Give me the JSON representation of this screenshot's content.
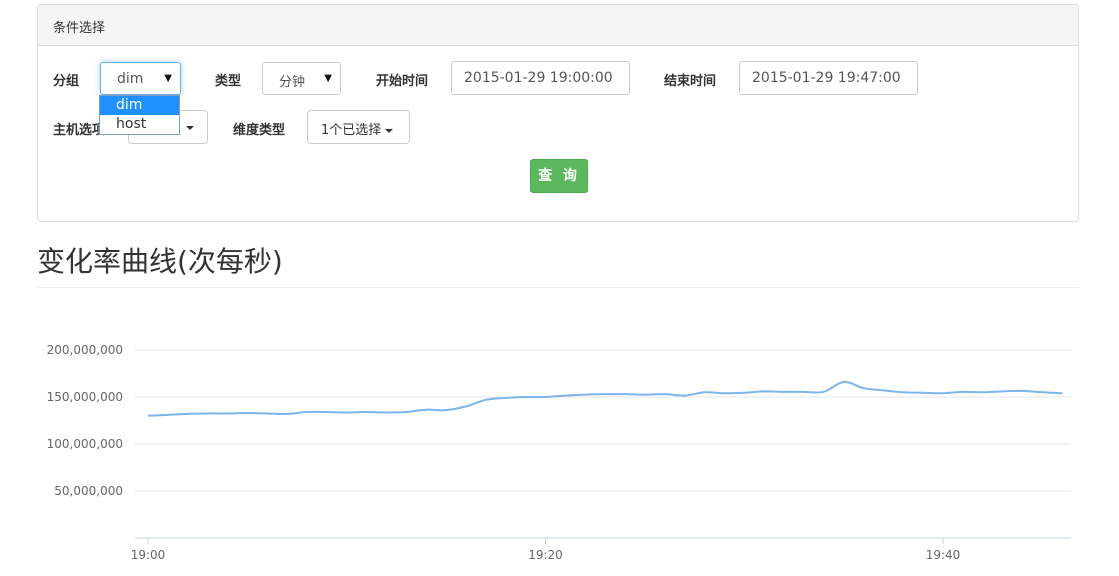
{
  "panel": {
    "title": "条件选择"
  },
  "filters": {
    "group": {
      "label": "分组",
      "value": "dim",
      "options": [
        "dim",
        "host"
      ]
    },
    "type": {
      "label": "类型",
      "value": "分钟"
    },
    "start_time": {
      "label": "开始时间",
      "value": "2015-01-29 19:00:00"
    },
    "end_time": {
      "label": "结束时间",
      "value": "2015-01-29 19:47:00"
    },
    "host_select": {
      "label": "主机选项",
      "value": ""
    },
    "dimension_type": {
      "label": "维度类型",
      "value": "1个已选择"
    },
    "query_button": "查 询"
  },
  "chart_title": "变化率曲线(次每秒)",
  "chart_data": {
    "type": "line",
    "title": "变化率曲线(次每秒)",
    "x_tick_labels": [
      "19:00",
      "19:20",
      "19:40"
    ],
    "y_tick_labels": [
      "50,000,000",
      "100,000,000",
      "150,000,000",
      "200,000,000"
    ],
    "ylim": [
      0,
      200000000
    ],
    "grid": true,
    "colors": {
      "line": "#7cb5ec"
    },
    "series": [
      {
        "x": [
          "19:00",
          "19:01",
          "19:02",
          "19:03",
          "19:04",
          "19:05",
          "19:06",
          "19:07",
          "19:08",
          "19:09",
          "19:10",
          "19:11",
          "19:12",
          "19:13",
          "19:14",
          "19:15",
          "19:16",
          "19:17",
          "19:18",
          "19:19",
          "19:20",
          "19:21",
          "19:22",
          "19:23",
          "19:24",
          "19:25",
          "19:26",
          "19:27",
          "19:28",
          "19:29",
          "19:30",
          "19:31",
          "19:32",
          "19:33",
          "19:34",
          "19:35",
          "19:36",
          "19:37",
          "19:38",
          "19:39",
          "19:40",
          "19:41",
          "19:42",
          "19:43",
          "19:44",
          "19:45",
          "19:46"
        ],
        "values": [
          130000000,
          131000000,
          132000000,
          132500000,
          132500000,
          133000000,
          132500000,
          132000000,
          134000000,
          134000000,
          133500000,
          134000000,
          133500000,
          134000000,
          136500000,
          136000000,
          140000000,
          147000000,
          149000000,
          150000000,
          150000000,
          151500000,
          152500000,
          153000000,
          153000000,
          152500000,
          153000000,
          151500000,
          155000000,
          154000000,
          154500000,
          156000000,
          155500000,
          155500000,
          155500000,
          166000000,
          159500000,
          157000000,
          155000000,
          154500000,
          154000000,
          155500000,
          155000000,
          156000000,
          156500000,
          155000000,
          154000000
        ]
      }
    ]
  }
}
